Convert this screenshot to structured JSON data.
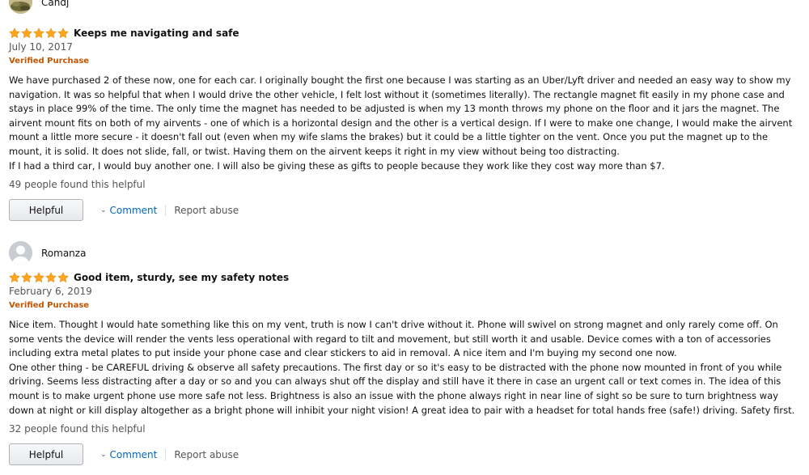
{
  "reviews": [
    {
      "profile_name": "Candj",
      "rating": 5,
      "title": "Keeps me navigating and safe",
      "date": "July 10, 2017",
      "verified": "Verified Purchase",
      "body": [
        "We have purchased 2 of these now, one for each car. I originally bought the first one because I was starting as an Uber/Lyft driver and needed an easy way to show my navigation. It was so helpful that when I would drive the other vehicle, I felt lost without it (sometimes literally). The rectangle magnet fit easily in my phone case and stays in place 99% of the time. The only time the magnet has needed to be adjusted is when my 13 month throws my phone on the floor and it jars the magnet. The airvent mount fits on both of my airvents - one of which is a horizontal design and the other is a vertical design. If I were to make one change, I would make the airvent mount a little more secure - it doesn't fall out (even when my wife slams the brakes) but it could be a little tighter on the vent. Once you put the magnet up to the mount, it is solid. It does not slide, fall, or twist. Having them on the airvent keeps it right in my view without being too distracting.",
        "If I had a third car, I would buy another one. I will also be giving these as gifts to people because they work like they cost way more than $7."
      ],
      "helpful_count": "49 people found this helpful",
      "helpful_label": "Helpful",
      "comment_label": "Comment",
      "report_label": "Report abuse"
    },
    {
      "profile_name": "Romanza",
      "rating": 5,
      "title": "Good item, sturdy, see my safety notes",
      "date": "February 6, 2019",
      "verified": "Verified Purchase",
      "body": [
        "Nice item. Thought I would hate something like this on my vent, truth is now I can't drive without it. Phone will swivel on strong magnet and only rarely come off. On some vents the device will render the vents less operational with regard to tilt and movement, but still worth it and usable. Device comes with a ton of accessories including extra metal plates to put inside your phone case and clear stickers to aid in removal. A nice item and I'm buying my second one now.",
        "One other thing - be CAREFUL driving & observe all safety precautions. The first day or so it's easy to be distracted with the phone now mounted in front of you while driving. Seems less distracting after a day or so and you can always shut off the display and still have it there in case an urgent call or text comes in. The idea of this mount is to make urgent phone use more safe not less. Brightness is also an issue with the phone always right in near line of sight so be sure to turn brightness way down at night or kill display altogether as a bright phone will inhibit your night vision! A great idea to pair with a headset for total hands free (safe!) driving. Safety first."
      ],
      "helpful_count": "32 people found this helpful",
      "helpful_label": "Helpful",
      "comment_label": "Comment",
      "report_label": "Report abuse"
    }
  ],
  "colors": {
    "star": "#ffa41c",
    "verified": "#c45500",
    "link": "#0066c0",
    "muted": "#555555"
  }
}
